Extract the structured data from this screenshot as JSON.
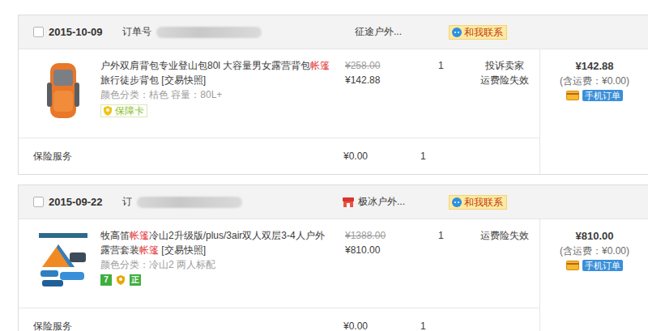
{
  "orders": [
    {
      "checked": false,
      "date": "2015-10-09",
      "order_label": "订单号",
      "shop": "征途户外...",
      "shop_icon": false,
      "contact": "和我联系",
      "items": [
        {
          "kind": "backpack",
          "title": [
            {
              "text": "户外双肩背包专业登山包80l 大容量男女露营背包",
              "highlight": false
            },
            {
              "text": "帐篷",
              "highlight": true
            },
            {
              "text": "旅行徒步背包",
              "highlight": false
            }
          ],
          "snapshot": "[交易快照]",
          "specs": "颜色分类：桔色  容量：80L+",
          "badges": [
            {
              "kind": "label",
              "text": "保障卡",
              "color": "#8cbf26"
            }
          ],
          "original_price": "¥258.00",
          "price": "¥142.88",
          "quantity": "1",
          "actions": [
            "投诉卖家",
            "运费险失效"
          ]
        }
      ],
      "total": "¥142.88",
      "shipping_note": "(含运费：¥0.00)",
      "mobile_label": "手机订单",
      "services": [
        {
          "name": "保险服务",
          "price": "¥0.00",
          "quantity": "1"
        }
      ]
    },
    {
      "checked": false,
      "date": "2015-09-22",
      "order_label": "订",
      "shop": "极冰户外...",
      "shop_icon": true,
      "contact": "和我联系",
      "items": [
        {
          "kind": "tent",
          "title": [
            {
              "text": "牧高笛",
              "highlight": false
            },
            {
              "text": "帐篷",
              "highlight": true
            },
            {
              "text": "冷山2升级版/plus/3air双人双层3-4人户外露营套装",
              "highlight": false
            },
            {
              "text": "帐篷",
              "highlight": true
            }
          ],
          "snapshot": "[交易快照]",
          "specs": "颜色分类：冷山2 两人标配",
          "badges": [
            {
              "kind": "square",
              "text": "7",
              "color": "#3fae3f"
            },
            {
              "kind": "icon",
              "color": "#e8a800"
            },
            {
              "kind": "square",
              "text": "正",
              "color": "#3fae3f"
            }
          ],
          "original_price": "¥1388.00",
          "price": "¥810.00",
          "quantity": "1",
          "actions": [
            "运费险失效"
          ]
        }
      ],
      "total": "¥810.00",
      "shipping_note": "(含运费：¥0.00)",
      "mobile_label": "手机订单",
      "services": [
        {
          "name": "保险服务",
          "price": "¥0.00",
          "quantity": "1"
        }
      ]
    }
  ]
}
